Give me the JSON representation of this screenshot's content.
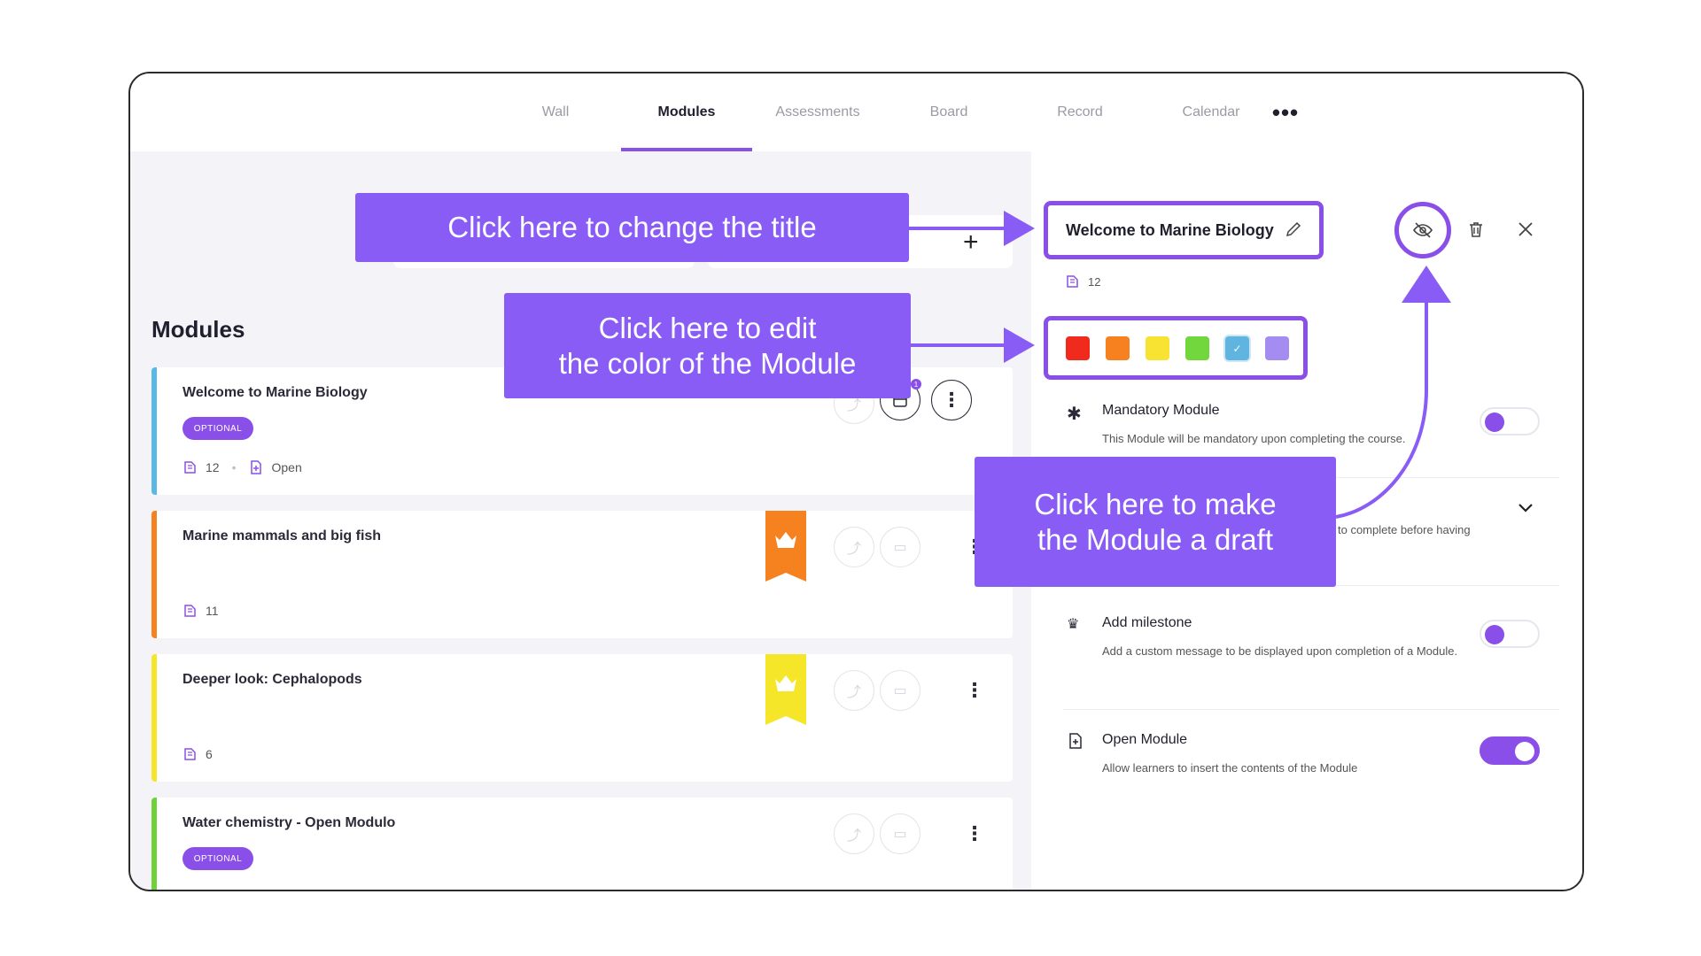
{
  "nav": {
    "tabs": [
      {
        "label": "Wall"
      },
      {
        "label": "Modules"
      },
      {
        "label": "Assessments"
      },
      {
        "label": "Board"
      },
      {
        "label": "Record"
      },
      {
        "label": "Calendar"
      }
    ],
    "more": "•••",
    "active": "Modules"
  },
  "left": {
    "plus": "+",
    "heading": "Modules",
    "modules": [
      {
        "title": "Welcome to Marine Biology",
        "badge": "OPTIONAL",
        "count": "12",
        "status": "Open",
        "color": "#5bb8e6"
      },
      {
        "title": "Marine mammals and big fish",
        "count": "11",
        "color": "#f5821f",
        "milestone": "#f5821f"
      },
      {
        "title": "Deeper look: Cephalopods",
        "count": "6",
        "color": "#f5e62a",
        "milestone": "#f5e62a"
      },
      {
        "title": "Water chemistry - Open Modulo",
        "badge": "OPTIONAL",
        "color": "#6fd23a"
      }
    ],
    "kebab": "⋮",
    "calendar_badge": "1"
  },
  "right": {
    "title": "Welcome to Marine Biology",
    "count": "12",
    "swatches": [
      "#f02b1d",
      "#f7801f",
      "#f8e332",
      "#72d73c",
      "#5fb4e0",
      "#a48cf0"
    ],
    "selected_swatch": 4,
    "checkmark": "✓",
    "settings": {
      "mandatory": {
        "title": "Mandatory Module",
        "desc": "This Module will be mandatory upon completing the course.",
        "on": false
      },
      "hidden_partial": "to complete before having",
      "milestone": {
        "title": "Add milestone",
        "desc": "Add a custom message to be displayed upon completion of a Module.",
        "on": false
      },
      "open": {
        "title": "Open Module",
        "desc": "Allow learners to insert the contents of the Module",
        "on": true
      }
    }
  },
  "callouts": {
    "title": "Click here to change the title",
    "color": "Click here to edit\nthe color of the Module",
    "draft": "Click here to make\nthe Module a draft"
  },
  "colors": {
    "accent": "#8a4fe8",
    "callout": "#8a5cf6"
  }
}
